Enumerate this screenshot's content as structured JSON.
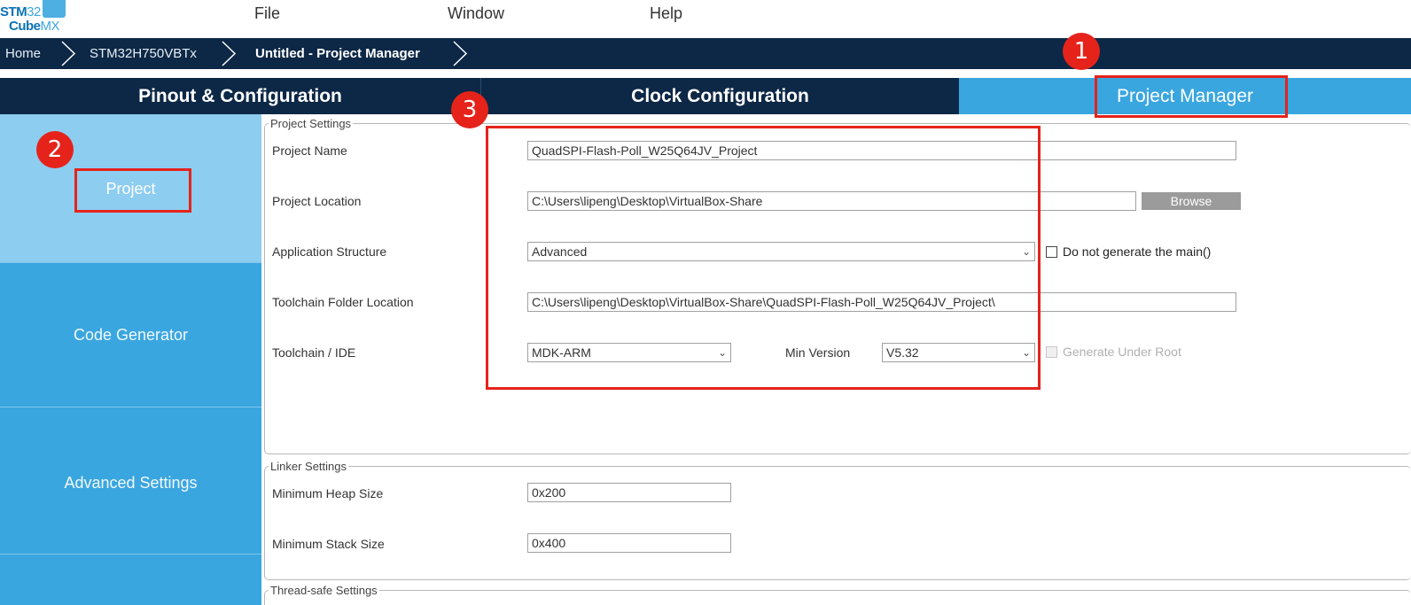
{
  "logo": {
    "line1_bold": "STM",
    "line1_rest": "32",
    "line2_bold": "Cube",
    "line2_rest": "MX"
  },
  "menu": {
    "items": [
      "File",
      "Window",
      "Help"
    ]
  },
  "breadcrumb": {
    "items": [
      "Home",
      "STM32H750VBTx",
      "Untitled - Project Manager"
    ]
  },
  "tabs": [
    {
      "label": "Pinout & Configuration",
      "active": false
    },
    {
      "label": "Clock Configuration",
      "active": false
    },
    {
      "label": "Project Manager",
      "active": true
    }
  ],
  "sidebar": {
    "items": [
      {
        "label": "Project",
        "active": true
      },
      {
        "label": "Code Generator",
        "active": false
      },
      {
        "label": "Advanced Settings",
        "active": false
      }
    ]
  },
  "project_settings": {
    "legend": "Project Settings",
    "project_name_label": "Project Name",
    "project_name_value": "QuadSPI-Flash-Poll_W25Q64JV_Project",
    "project_location_label": "Project Location",
    "project_location_value": "C:\\Users\\lipeng\\Desktop\\VirtualBox-Share",
    "browse_label": "Browse",
    "app_structure_label": "Application Structure",
    "app_structure_value": "Advanced",
    "no_main_label": "Do not generate the main()",
    "no_main_checked": false,
    "toolchain_folder_label": "Toolchain Folder Location",
    "toolchain_folder_value": "C:\\Users\\lipeng\\Desktop\\VirtualBox-Share\\QuadSPI-Flash-Poll_W25Q64JV_Project\\",
    "toolchain_ide_label": "Toolchain / IDE",
    "toolchain_ide_value": "MDK-ARM",
    "min_version_label": "Min Version",
    "min_version_value": "V5.32",
    "generate_under_root_label": "Generate Under Root",
    "generate_under_root_checked": false
  },
  "linker_settings": {
    "legend": "Linker Settings",
    "heap_label": "Minimum Heap Size",
    "heap_value": "0x200",
    "stack_label": "Minimum Stack Size",
    "stack_value": "0x400"
  },
  "thread_safe": {
    "legend": "Thread-safe Settings"
  },
  "annotations": {
    "badge1": "1",
    "badge2": "2",
    "badge3": "3",
    "color": "#e5231b"
  },
  "colors": {
    "navy": "#0d2846",
    "accent": "#3aa6df",
    "active_nav": "#8dcdf0"
  }
}
